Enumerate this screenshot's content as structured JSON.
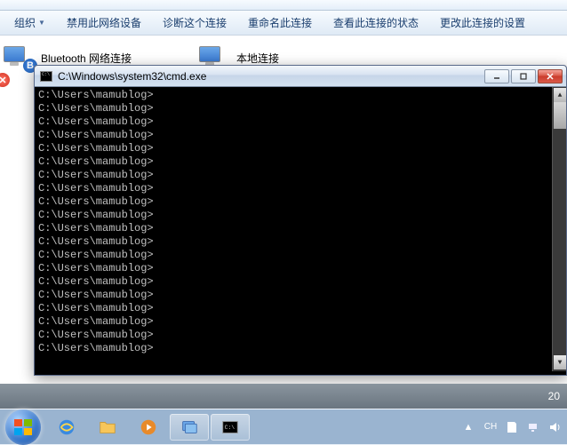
{
  "toolbar": {
    "organize": "组织",
    "disable": "禁用此网络设备",
    "diagnose": "诊断这个连接",
    "rename": "重命名此连接",
    "status": "查看此连接的状态",
    "change": "更改此连接的设置"
  },
  "connections": {
    "bluetooth": "Bluetooth 网络连接",
    "local": "本地连接"
  },
  "cmd": {
    "title": "C:\\Windows\\system32\\cmd.exe",
    "prompt": "C:\\Users\\mamublog>",
    "lines": 20
  },
  "statusbar": {
    "items_right": "20"
  },
  "tray": {
    "lang": "CH"
  }
}
